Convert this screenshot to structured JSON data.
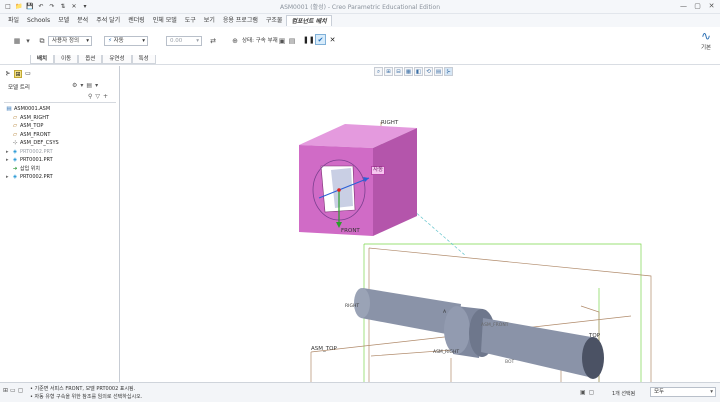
{
  "title_bar": {
    "title": "ASM0001 (활성) - Creo Parametric Educational Edition",
    "quick_access": [
      "□",
      "📁",
      "💾",
      "↶",
      "↷",
      "⇅",
      "✕",
      "▾"
    ],
    "window_buttons": [
      "—",
      "▢",
      "✕"
    ]
  },
  "menu": {
    "tabs": [
      "파일",
      "Schools",
      "모델",
      "분석",
      "주석 달기",
      "렌더링",
      "인체 모델",
      "도구",
      "보기",
      "응용 프로그램",
      "구조물",
      "컴포넌트 배치"
    ],
    "active_index": 11
  },
  "ribbon": {
    "constraint_set": "사용자 정의",
    "constraint_type": "자동",
    "offset_value": "0.00",
    "status_label": "상태: 구속 부재",
    "subtabs": [
      "배치",
      "이동",
      "옵션",
      "유연성",
      "특성"
    ],
    "active_subtab": 0,
    "right_label": "기본"
  },
  "panel": {
    "header": "모델 트리",
    "items": [
      {
        "label": "ASM0001.ASM",
        "icon": "assembly",
        "indent": 0,
        "expand": "",
        "gray": false
      },
      {
        "label": "ASM_RIGHT",
        "icon": "datum-plane",
        "indent": 1,
        "expand": "",
        "gray": false
      },
      {
        "label": "ASM_TOP",
        "icon": "datum-plane",
        "indent": 1,
        "expand": "",
        "gray": false
      },
      {
        "label": "ASM_FRONT",
        "icon": "datum-plane",
        "indent": 1,
        "expand": "",
        "gray": false
      },
      {
        "label": "ASM_DEF_CSYS",
        "icon": "csys",
        "indent": 1,
        "expand": "",
        "gray": false
      },
      {
        "label": "PRT0002.PRT",
        "icon": "part",
        "indent": 1,
        "expand": "▸",
        "gray": true
      },
      {
        "label": "PRT0001.PRT",
        "icon": "part",
        "indent": 1,
        "expand": "▸",
        "gray": false
      },
      {
        "label": "삽입 위치",
        "icon": "insert",
        "indent": 1,
        "expand": "",
        "gray": false
      },
      {
        "label": "PRT0002.PRT",
        "icon": "part",
        "indent": 1,
        "expand": "▸",
        "gray": false
      }
    ]
  },
  "viewport": {
    "labels": {
      "right_top": "RIGHT",
      "front": "FRONT",
      "auto": "자동",
      "right_small": "RIGHT",
      "asm_top": "ASM_TOP",
      "top": "TOP",
      "asm_front": "ASM_FRONT",
      "asm_right": "ASM_RIGHT",
      "a": "A",
      "bot": "BOT"
    },
    "colors": {
      "block": "#d06bc6",
      "shaft": "#8a93a8",
      "datum": "#b08a6a",
      "green": "#7bd64b"
    }
  },
  "status": {
    "messages": [
      "• 기준면 서피스 FRONT, 모델 PRT0002 표시됨.",
      "• 자동 유형 구속을 위한 참조를 임의로 선택하십시오."
    ],
    "selection": "1개 선택됨",
    "filter": "모두"
  }
}
